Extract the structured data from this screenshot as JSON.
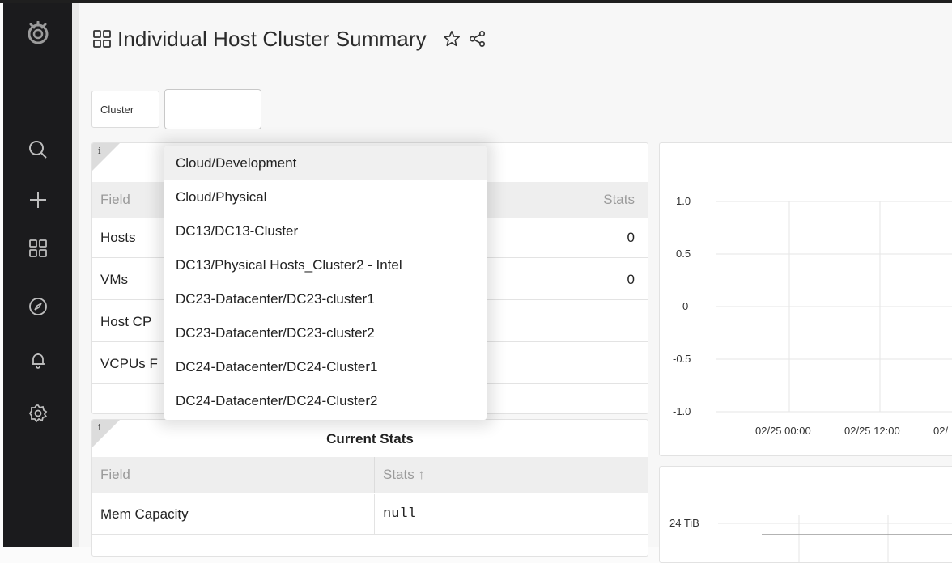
{
  "page": {
    "title": "Individual Host Cluster Summary"
  },
  "sidebar": {
    "items": [
      {
        "icon": "grafana-logo-icon"
      },
      {
        "icon": "search-icon"
      },
      {
        "icon": "plus-icon"
      },
      {
        "icon": "dashboards-grid-icon"
      },
      {
        "icon": "compass-explore-icon"
      },
      {
        "icon": "bell-alerting-icon"
      },
      {
        "icon": "gear-icon"
      }
    ]
  },
  "variables": {
    "cluster_label": "Cluster",
    "cluster_value": ""
  },
  "dropdown": {
    "options": [
      "Cloud/Development",
      "Cloud/Physical",
      "DC13/DC13-Cluster",
      "DC13/Physical Hosts_Cluster2 - Intel",
      "DC23-Datacenter/DC23-cluster1",
      "DC23-Datacenter/DC23-cluster2",
      "DC24-Datacenter/DC24-Cluster1",
      "DC24-Datacenter/DC24-Cluster2"
    ],
    "highlighted": "Cloud/Development"
  },
  "panel1": {
    "info_icon": "i",
    "headers": {
      "field": "Field",
      "stats": "Stats"
    },
    "rows": [
      {
        "field": "Hosts",
        "stats": "0"
      },
      {
        "field": "VMs",
        "stats": "0"
      },
      {
        "field": "Host CP",
        "stats": ""
      },
      {
        "field": "VCPUs F",
        "stats": ""
      }
    ]
  },
  "panel2": {
    "info_icon": "i",
    "title": "Current Stats",
    "headers": {
      "field": "Field",
      "stats": "Stats ↑"
    },
    "rows": [
      {
        "field": "Mem Capacity",
        "stats": "null"
      }
    ]
  },
  "chart_data": [
    {
      "type": "line",
      "ylim": [
        -1.0,
        1.0
      ],
      "y_ticks": [
        "1.0",
        "0.5",
        "0",
        "-0.5",
        "-1.0"
      ],
      "x_ticks": [
        "02/25 00:00",
        "02/25 12:00",
        "02/"
      ],
      "series": []
    },
    {
      "type": "line",
      "y_ticks": [
        "24 TiB"
      ],
      "series": []
    }
  ],
  "colors": {
    "sidebar_bg": "#1b1b1d",
    "panel_header_bg": "#eeeeee",
    "dropdown_highlight": "#f0f0f0"
  }
}
